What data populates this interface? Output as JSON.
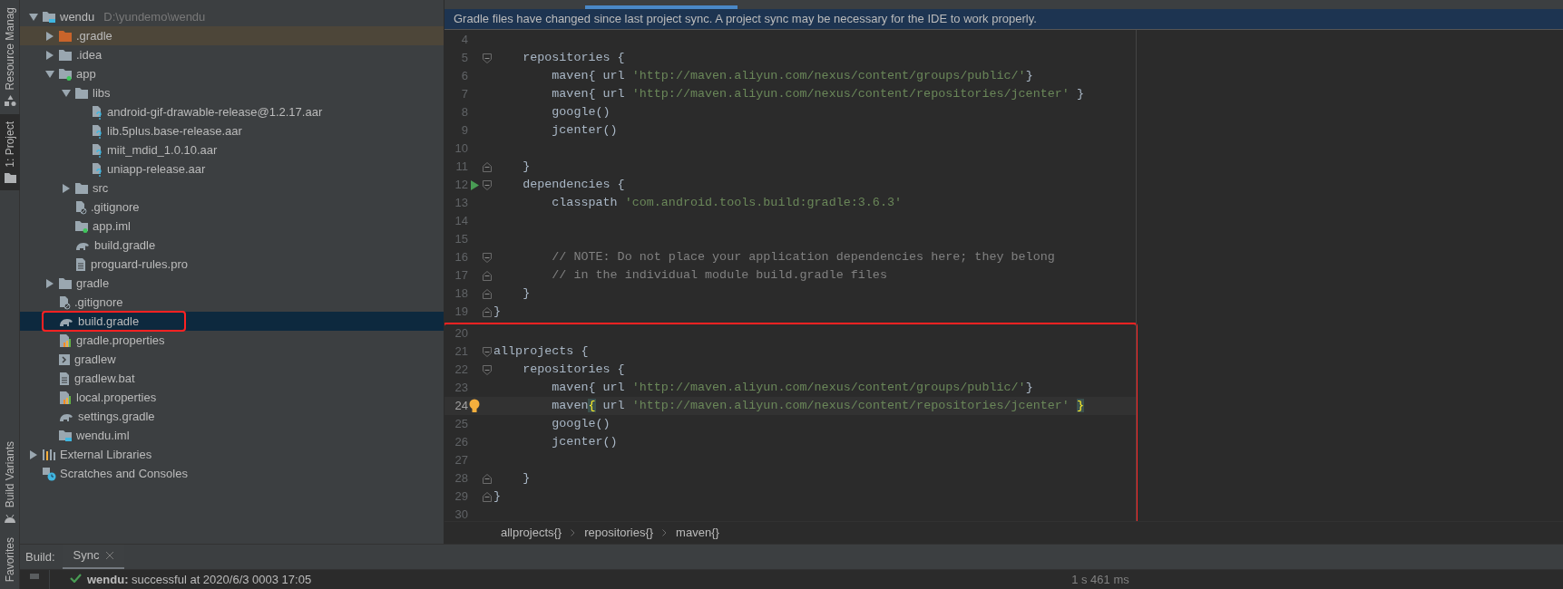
{
  "tool_strip": {
    "top_tabs": [
      {
        "label": "Resource Manag",
        "kind": "resources",
        "selected": false
      },
      {
        "label": "1: Project",
        "kind": "folder",
        "selected": true
      }
    ],
    "bottom_tabs": [
      {
        "label": "Build Variants",
        "kind": "android",
        "selected": false
      },
      {
        "label": "Favorites",
        "selected": false
      }
    ]
  },
  "project_tree": {
    "items": [
      {
        "label": "wendu",
        "hint": "D:\\yundemo\\wendu",
        "kind": "module",
        "expanded": true,
        "selected": false,
        "highlighted": false,
        "outlined": false,
        "children": [
          {
            "label": ".gradle",
            "kind": "folder-excluded",
            "expanded": false,
            "selected": false,
            "highlighted": true,
            "outlined": false
          },
          {
            "label": ".idea",
            "kind": "folder",
            "expanded": false,
            "selected": false,
            "highlighted": false,
            "outlined": false
          },
          {
            "label": "app",
            "kind": "module-folder",
            "expanded": true,
            "selected": false,
            "highlighted": false,
            "outlined": false,
            "children": [
              {
                "label": "libs",
                "kind": "folder",
                "expanded": true,
                "selected": false,
                "highlighted": false,
                "outlined": false,
                "children": [
                  {
                    "label": "android-gif-drawable-release@1.2.17.aar",
                    "kind": "unknown-file",
                    "selected": false,
                    "highlighted": false,
                    "outlined": false
                  },
                  {
                    "label": "lib.5plus.base-release.aar",
                    "kind": "unknown-file",
                    "selected": false,
                    "highlighted": false,
                    "outlined": false
                  },
                  {
                    "label": "miit_mdid_1.0.10.aar",
                    "kind": "unknown-file",
                    "selected": false,
                    "highlighted": false,
                    "outlined": false
                  },
                  {
                    "label": "uniapp-release.aar",
                    "kind": "unknown-file",
                    "selected": false,
                    "highlighted": false,
                    "outlined": false
                  }
                ]
              },
              {
                "label": "src",
                "kind": "folder",
                "expanded": false,
                "selected": false,
                "highlighted": false,
                "outlined": false
              },
              {
                "label": ".gitignore",
                "kind": "ignore-file",
                "selected": false,
                "highlighted": false,
                "outlined": false
              },
              {
                "label": "app.iml",
                "kind": "module-folder",
                "selected": false,
                "highlighted": false,
                "outlined": false
              },
              {
                "label": "build.gradle",
                "kind": "gradle",
                "selected": false,
                "highlighted": false,
                "outlined": false
              },
              {
                "label": "proguard-rules.pro",
                "kind": "text-file",
                "selected": false,
                "highlighted": false,
                "outlined": false
              }
            ]
          },
          {
            "label": "gradle",
            "kind": "folder",
            "expanded": false,
            "selected": false,
            "highlighted": false,
            "outlined": false
          },
          {
            "label": ".gitignore",
            "kind": "ignore-file",
            "selected": false,
            "highlighted": false,
            "outlined": false
          },
          {
            "label": "build.gradle",
            "kind": "gradle",
            "selected": true,
            "highlighted": false,
            "outlined": true
          },
          {
            "label": "gradle.properties",
            "kind": "properties-file",
            "selected": false,
            "highlighted": false,
            "outlined": false
          },
          {
            "label": "gradlew",
            "kind": "script-file",
            "selected": false,
            "highlighted": false,
            "outlined": false
          },
          {
            "label": "gradlew.bat",
            "kind": "text-file",
            "selected": false,
            "highlighted": false,
            "outlined": false
          },
          {
            "label": "local.properties",
            "kind": "properties-file",
            "selected": false,
            "highlighted": false,
            "outlined": false
          },
          {
            "label": "settings.gradle",
            "kind": "gradle",
            "selected": false,
            "highlighted": false,
            "outlined": false
          },
          {
            "label": "wendu.iml",
            "kind": "module",
            "selected": false,
            "highlighted": false,
            "outlined": false
          }
        ]
      },
      {
        "label": "External Libraries",
        "kind": "libraries",
        "expanded": false,
        "selected": false,
        "highlighted": false,
        "outlined": false
      },
      {
        "label": "Scratches and Consoles",
        "kind": "scratches",
        "selected": false,
        "highlighted": false,
        "outlined": false
      }
    ]
  },
  "editor": {
    "notification": "Gradle files have changed since last project sync. A project sync may be necessary for the IDE to work properly.",
    "blocks": [
      {
        "outlined": false,
        "lines": [
          {
            "number": "4",
            "current": false
          },
          {
            "number": "5",
            "markers": [
              {
                "kind": "fold-start"
              }
            ],
            "current": false,
            "segments": [
              {
                "kind": "code",
                "text": "    repositories {"
              }
            ]
          },
          {
            "number": "6",
            "current": false,
            "segments": [
              {
                "kind": "code",
                "text": "        maven{ url "
              },
              {
                "kind": "string",
                "text": "'http://maven.aliyun.com/nexus/content/groups/public/'"
              },
              {
                "kind": "code",
                "text": "}"
              }
            ]
          },
          {
            "number": "7",
            "current": false,
            "segments": [
              {
                "kind": "code",
                "text": "        maven{ url "
              },
              {
                "kind": "string",
                "text": "'http://maven.aliyun.com/nexus/content/repositories/jcenter'"
              },
              {
                "kind": "code",
                "text": " }"
              }
            ]
          },
          {
            "number": "8",
            "current": false,
            "segments": [
              {
                "kind": "code",
                "text": "        google()"
              }
            ]
          },
          {
            "number": "9",
            "current": false,
            "segments": [
              {
                "kind": "code",
                "text": "        jcenter()"
              }
            ]
          },
          {
            "number": "10",
            "current": false
          },
          {
            "number": "11",
            "markers": [
              {
                "kind": "fold-end"
              }
            ],
            "current": false,
            "segments": [
              {
                "kind": "code",
                "text": "    }"
              }
            ]
          },
          {
            "number": "12",
            "markers": [
              {
                "kind": "run"
              },
              {
                "kind": "fold-start"
              }
            ],
            "current": false,
            "segments": [
              {
                "kind": "code",
                "text": "    dependencies {"
              }
            ]
          },
          {
            "number": "13",
            "current": false,
            "segments": [
              {
                "kind": "code",
                "text": "        classpath "
              },
              {
                "kind": "string",
                "text": "'com.android.tools.build:gradle:3.6.3'"
              }
            ]
          },
          {
            "number": "14",
            "current": false
          },
          {
            "number": "15",
            "current": false
          },
          {
            "number": "16",
            "markers": [
              {
                "kind": "fold-start"
              }
            ],
            "current": false,
            "segments": [
              {
                "kind": "comment",
                "text": "        // NOTE: Do not place your application dependencies here; they belong"
              }
            ]
          },
          {
            "number": "17",
            "markers": [
              {
                "kind": "fold-end"
              }
            ],
            "current": false,
            "segments": [
              {
                "kind": "comment",
                "text": "        // in the individual module build.gradle files"
              }
            ]
          },
          {
            "number": "18",
            "markers": [
              {
                "kind": "fold-end"
              }
            ],
            "current": false,
            "segments": [
              {
                "kind": "code",
                "text": "    }"
              }
            ]
          },
          {
            "number": "19",
            "markers": [
              {
                "kind": "fold-end"
              }
            ],
            "current": false,
            "segments": [
              {
                "kind": "code",
                "text": "}"
              }
            ]
          }
        ]
      },
      {
        "outlined": true,
        "lines": [
          {
            "number": "20",
            "current": false
          },
          {
            "number": "21",
            "markers": [
              {
                "kind": "fold-start"
              }
            ],
            "current": false,
            "segments": [
              {
                "kind": "code",
                "text": "allprojects {"
              }
            ]
          },
          {
            "number": "22",
            "markers": [
              {
                "kind": "fold-start"
              }
            ],
            "current": false,
            "segments": [
              {
                "kind": "code",
                "text": "    repositories {"
              }
            ]
          },
          {
            "number": "23",
            "current": false,
            "segments": [
              {
                "kind": "code",
                "text": "        maven{ url "
              },
              {
                "kind": "string",
                "text": "'http://maven.aliyun.com/nexus/content/groups/public/'"
              },
              {
                "kind": "code",
                "text": "}"
              }
            ]
          },
          {
            "number": "24",
            "markers": [
              {
                "kind": "bulb"
              }
            ],
            "current": true,
            "segments": [
              {
                "kind": "code",
                "text": "        maven"
              },
              {
                "kind": "brace",
                "text": "{"
              },
              {
                "kind": "code",
                "text": " url "
              },
              {
                "kind": "string",
                "text": "'http://maven.aliyun.com/nexus/content/repositories/jcenter' "
              },
              {
                "kind": "brace",
                "text": "}"
              }
            ]
          },
          {
            "number": "25",
            "current": false,
            "segments": [
              {
                "kind": "code",
                "text": "        google()"
              }
            ]
          },
          {
            "number": "26",
            "current": false,
            "segments": [
              {
                "kind": "code",
                "text": "        jcenter()"
              }
            ]
          },
          {
            "number": "27",
            "current": false
          },
          {
            "number": "28",
            "markers": [
              {
                "kind": "fold-end"
              }
            ],
            "current": false,
            "segments": [
              {
                "kind": "code",
                "text": "    }"
              }
            ]
          },
          {
            "number": "29",
            "markers": [
              {
                "kind": "fold-end"
              }
            ],
            "current": false,
            "segments": [
              {
                "kind": "code",
                "text": "}"
              }
            ]
          },
          {
            "number": "30",
            "current": false
          }
        ]
      }
    ],
    "breadcrumbs": [
      "allprojects{}",
      "repositories{}",
      "maven{}"
    ]
  },
  "build_panel": {
    "title": "Build:",
    "tabs": [
      {
        "label": "Sync",
        "selected": true
      }
    ],
    "rows": [
      {
        "kind": "success",
        "text": "**wendu:** successful at 2020/6/3 0003 17:05",
        "duration": "1 s 461 ms"
      }
    ]
  }
}
